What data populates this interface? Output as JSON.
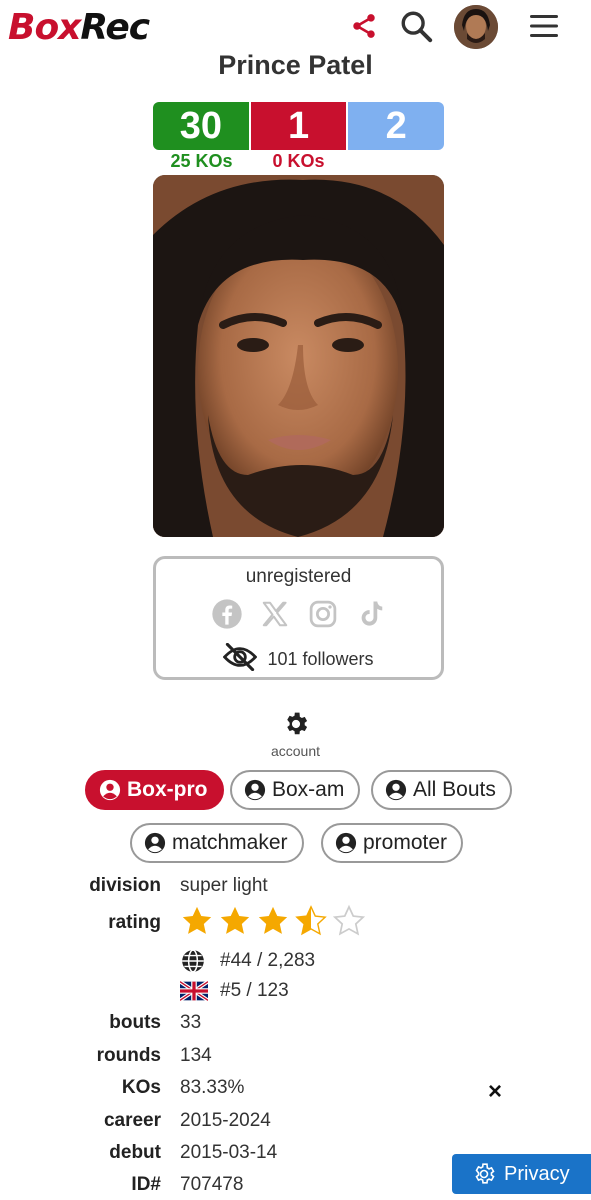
{
  "header": {
    "logo_box": "Box",
    "logo_rec": "Rec"
  },
  "boxer": {
    "name": "Prince Patel",
    "wins": "30",
    "losses": "1",
    "draws": "2",
    "win_kos": "25 KOs",
    "loss_kos": "0 KOs"
  },
  "status": {
    "text": "unregistered",
    "followers": "101 followers"
  },
  "account": {
    "label": "account"
  },
  "tabs": [
    {
      "label": "Box-pro",
      "active": true
    },
    {
      "label": "Box-am"
    },
    {
      "label": "All Bouts"
    },
    {
      "label": "matchmaker"
    },
    {
      "label": "promoter"
    }
  ],
  "info": {
    "division_label": "division",
    "division": "super light",
    "rating_label": "rating",
    "rating_stars": 3.5,
    "rating_max": 5,
    "world_rank": "#44 / 2,283",
    "uk_rank": "#5 / 123",
    "bouts_label": "bouts",
    "bouts": "33",
    "rounds_label": "rounds",
    "rounds": "134",
    "kos_label": "KOs",
    "kos": "83.33%",
    "career_label": "career",
    "career": "2015-2024",
    "debut_label": "debut",
    "debut": "2015-03-14",
    "id_label": "ID#",
    "id": "707478"
  },
  "overlay": {
    "close": "×",
    "privacy": "Privacy"
  },
  "colors": {
    "brand_red": "#c8102e",
    "win_green": "#1f8f1f",
    "draw_blue": "#7fb0f0",
    "star_gold": "#f5a800",
    "privacy_blue": "#1a73c8"
  }
}
